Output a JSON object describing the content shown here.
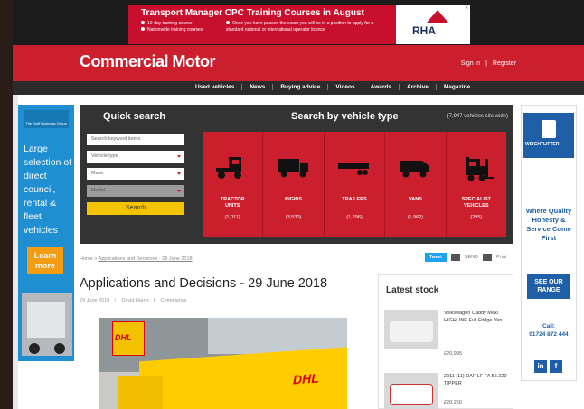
{
  "banner": {
    "title": "Transport Manager CPC Training Courses in August",
    "point1": "10-day training course",
    "point2": "Nationwide training courses",
    "point3": "Once you have passed the exam you will be in a position to apply for a standard national or international operator licence",
    "logo_text": "RHA",
    "close": "x"
  },
  "header": {
    "logo": "Commercial Motor",
    "sign_in": "Sign in",
    "separator": "|",
    "register": "Register"
  },
  "nav": {
    "items": [
      "Used vehicles",
      "News",
      "Buying advice",
      "Videos",
      "Awards",
      "Archive",
      "Magazine"
    ]
  },
  "left_ad": {
    "brand": "The Stuff Business Group",
    "text": "Large selection of direct council, rental & fleet vehicles",
    "button": "Learn more"
  },
  "right_ad": {
    "brand": "WEIGHTLIFTER",
    "tagline": "Where Quality Honesty & Service Come First",
    "button": "SEE OUR RANGE",
    "call_label": "Call:",
    "phone": "01724 872 444",
    "social1": "in",
    "social2": "f"
  },
  "search": {
    "quick_title": "Quick search",
    "keyword_placeholder": "Search keyword items",
    "vehicle_type": "Vehicle type",
    "make": "Make",
    "model": "Model",
    "button": "Search",
    "by_type_title": "Search by vehicle type",
    "count_text": "(7,947 vehicles site wide)",
    "types": [
      {
        "label1": "TRACTOR",
        "label2": "UNITS",
        "count": "(1,011)",
        "icon": "tractor-unit-icon"
      },
      {
        "label1": "RIGIDS",
        "label2": "",
        "count": "(3,530)",
        "icon": "rigid-truck-icon"
      },
      {
        "label1": "TRAILERS",
        "label2": "",
        "count": "(1,296)",
        "icon": "trailer-icon"
      },
      {
        "label1": "VANS",
        "label2": "",
        "count": "(1,962)",
        "icon": "van-icon"
      },
      {
        "label1": "SPECIALIST",
        "label2": "VEHICLES",
        "count": "(295)",
        "icon": "forklift-icon"
      }
    ]
  },
  "breadcrumb": {
    "home": "Home",
    "sep": ">",
    "current": "Applications and Decisions - 29 June 2018"
  },
  "share": {
    "tweet": "Tweet",
    "email": "SEND",
    "print": "Print"
  },
  "article": {
    "title": "Applications and Decisions - 29 June 2018",
    "date": "29 June 2018",
    "author": "David Harris",
    "category": "Compliance",
    "sep": "|"
  },
  "photo": {
    "sign_text": "DHL",
    "truck_text": "DHL"
  },
  "stock": {
    "title": "Latest stock",
    "items": [
      {
        "title": "Volkswagen Caddy Maxi HIGHLINE Full Fridge Van",
        "price": "£20,995"
      },
      {
        "title": "2011 (11) DAF LF FA 55.220 TIPPER",
        "price": "£20,250"
      }
    ]
  },
  "colors": {
    "brand_red": "#cc1f2d",
    "nav_dark": "#2b2b2b",
    "search_yellow": "#f5c400",
    "ad_blue": "#1f8fd1"
  }
}
